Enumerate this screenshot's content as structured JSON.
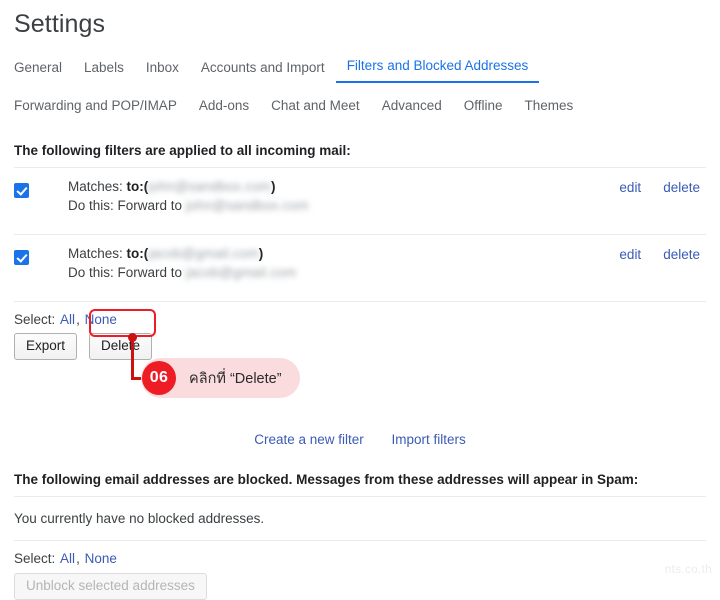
{
  "header": {
    "title": "Settings"
  },
  "tabs": {
    "row1": [
      {
        "label": "General",
        "active": false
      },
      {
        "label": "Labels",
        "active": false
      },
      {
        "label": "Inbox",
        "active": false
      },
      {
        "label": "Accounts and Import",
        "active": false
      },
      {
        "label": "Filters and Blocked Addresses",
        "active": true
      }
    ],
    "row2": [
      {
        "label": "Forwarding and POP/IMAP",
        "active": false
      },
      {
        "label": "Add-ons",
        "active": false
      },
      {
        "label": "Chat and Meet",
        "active": false
      },
      {
        "label": "Advanced",
        "active": false
      },
      {
        "label": "Offline",
        "active": false
      },
      {
        "label": "Themes",
        "active": false
      }
    ]
  },
  "filters_section": {
    "heading": "The following filters are applied to all incoming mail:",
    "rows": [
      {
        "checked": true,
        "matches_label": "Matches:",
        "matches_key": "to:(",
        "matches_value": "john@sandbox.com",
        "matches_close": ")",
        "action_label": "Do this: Forward to",
        "action_value": "john@sandbox.com",
        "edit_label": "edit",
        "delete_label": "delete"
      },
      {
        "checked": true,
        "matches_label": "Matches:",
        "matches_key": "to:(",
        "matches_value": "jacob@gmail.com",
        "matches_close": ")",
        "action_label": "Do this: Forward to",
        "action_value": "jacob@gmail.com",
        "edit_label": "edit",
        "delete_label": "delete"
      }
    ],
    "select_label": "Select:",
    "select_all": "All",
    "select_sep": ",",
    "select_none": "None",
    "export_button": "Export",
    "delete_button": "Delete",
    "create_filter_link": "Create a new filter",
    "import_filters_link": "Import filters"
  },
  "blocked_section": {
    "heading": "The following email addresses are blocked. Messages from these addresses will appear in Spam:",
    "empty_text": "You currently have no blocked addresses.",
    "select_label": "Select:",
    "select_all": "All",
    "select_sep": ",",
    "select_none": "None",
    "unblock_button": "Unblock selected addresses"
  },
  "annotation": {
    "step_number": "06",
    "text": "คลิกที่ “Delete”",
    "highlight_color": "#ee1c25",
    "pill_color": "#fadcdf"
  },
  "watermark": {
    "text": "nts.co.th"
  }
}
